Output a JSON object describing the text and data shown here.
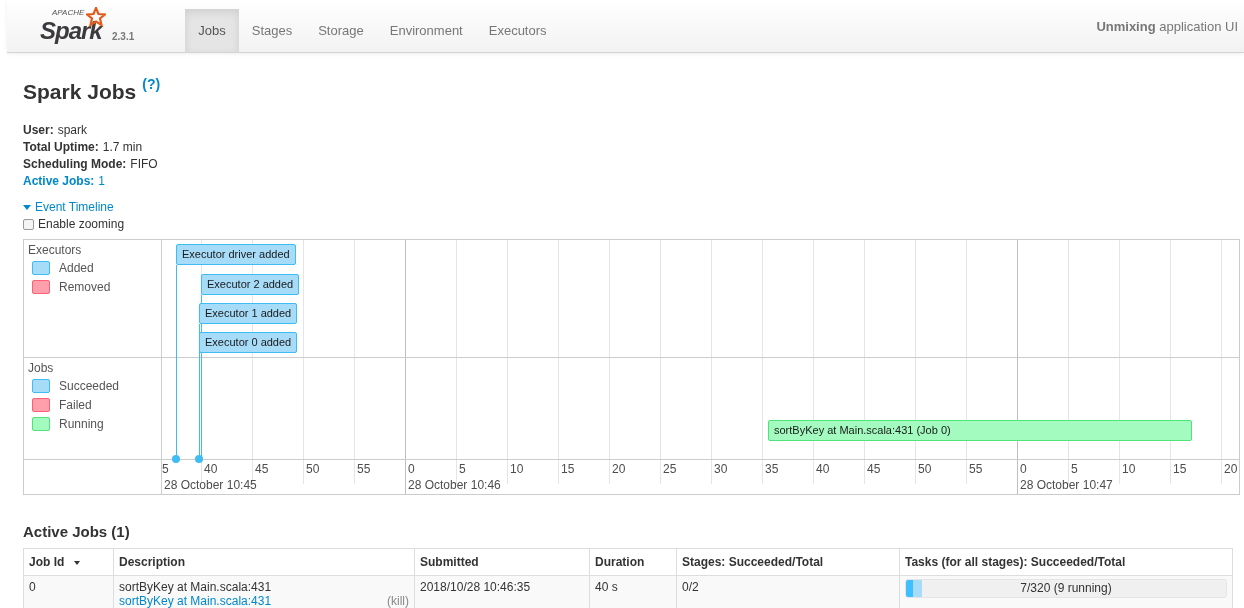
{
  "navbar": {
    "logo": {
      "small": "APACHE",
      "name": "Spark"
    },
    "version": "2.3.1",
    "tabs": [
      {
        "label": "Jobs",
        "selected": true
      },
      {
        "label": "Stages",
        "selected": false
      },
      {
        "label": "Storage",
        "selected": false
      },
      {
        "label": "Environment",
        "selected": false
      },
      {
        "label": "Executors",
        "selected": false
      }
    ],
    "app_title": "**Unmixing** application UI"
  },
  "page": {
    "title": "Spark Jobs",
    "help": "(?)",
    "summary": [
      {
        "label": "User:",
        "value": "spark",
        "kind": "plain"
      },
      {
        "label": "Total Uptime:",
        "value": "1.7 min",
        "kind": "plain"
      },
      {
        "label": "Scheduling Mode:",
        "value": "FIFO",
        "kind": "plain"
      },
      {
        "label": "Active Jobs:",
        "value": "1",
        "kind": "link"
      }
    ],
    "timeline_toggle": {
      "label": "Event Timeline",
      "expanded": true
    },
    "zoom_option": {
      "label": "Enable zooming",
      "checked": false
    }
  },
  "timeline": {
    "groups": [
      {
        "title": "Executors",
        "legend": [
          {
            "label": "Added",
            "color": "#a6dcf8"
          },
          {
            "label": "Removed",
            "color": "#ff9fab"
          }
        ],
        "events": [
          {
            "label": "Executor driver added",
            "color": "#a6dcf8"
          },
          {
            "label": "Executor 2 added",
            "color": "#a6dcf8"
          },
          {
            "label": "Executor 1 added",
            "color": "#a6dcf8"
          },
          {
            "label": "Executor 0 added",
            "color": "#a6dcf8"
          }
        ]
      },
      {
        "title": "Jobs",
        "legend": [
          {
            "label": "Succeeded",
            "color": "#a6dcf8"
          },
          {
            "label": "Failed",
            "color": "#ff9fab"
          },
          {
            "label": "Running",
            "color": "#a3fbbf"
          }
        ],
        "events": [
          {
            "label": "sortByKey at Main.scala:431 (Job 0)",
            "color": "#a3fbbf"
          }
        ]
      }
    ],
    "ticks": [
      "5",
      "40",
      "45",
      "50",
      "55",
      "0",
      "5",
      "10",
      "15",
      "20",
      "25",
      "30",
      "35",
      "40",
      "45",
      "50",
      "55",
      "0",
      "5",
      "10",
      "15",
      "20"
    ],
    "dates": [
      "28 October 10:45",
      "28 October 10:46",
      "28 October 10:47"
    ]
  },
  "active_jobs": {
    "title": "Active Jobs (1)",
    "columns": [
      {
        "label": "Job Id",
        "sorted": true
      },
      {
        "label": "Description",
        "sorted": false
      },
      {
        "label": "Submitted",
        "sorted": false
      },
      {
        "label": "Duration",
        "sorted": false
      },
      {
        "label": "Stages: Succeeded/Total",
        "sorted": false
      },
      {
        "label": "Tasks (for all stages): Succeeded/Total",
        "sorted": false
      }
    ],
    "rows": [
      {
        "job_id": "0",
        "description": "sortByKey at Main.scala:431",
        "description_link": "sortByKey at Main.scala:431",
        "kill": "(kill)",
        "submitted": "2018/10/28 10:46:35",
        "duration": "40 s",
        "stages": "0/2",
        "tasks": {
          "text": "7/320 (9 running)",
          "segments": [
            {
              "kind": "succeeded",
              "level": 0.022
            },
            {
              "kind": "running",
              "level": 0.028
            }
          ]
        }
      }
    ]
  }
}
